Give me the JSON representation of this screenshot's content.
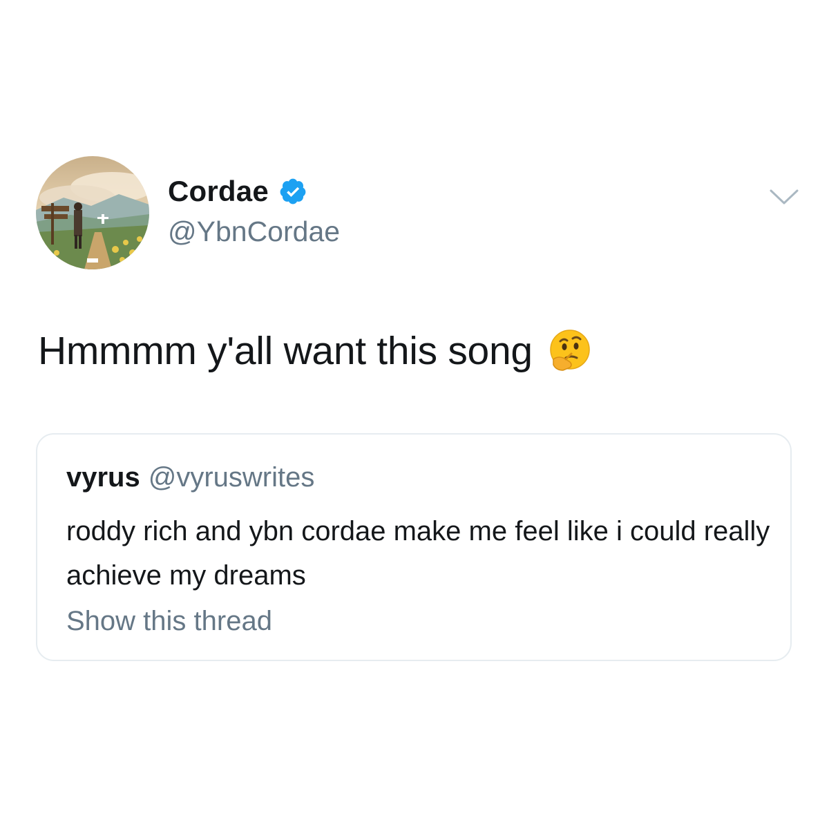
{
  "tweet": {
    "author": {
      "display_name": "Cordae",
      "handle": "@YbnCordae",
      "verified": true,
      "avatar_icon": "album-art-avatar"
    },
    "text": "Hmmmm y'all want this song",
    "emoji": "thinking-face-icon",
    "menu_icon": "chevron-down-icon",
    "quoted_tweet": {
      "display_name": "vyrus",
      "handle": "@vyruswrites",
      "text": "roddy rich and ybn cordae make me feel like i could really achieve my dreams",
      "show_thread_label": "Show this thread"
    }
  },
  "colors": {
    "text_primary": "#14171a",
    "text_secondary": "#657786",
    "verified_blue": "#1da1f2",
    "border": "#e6ecf0"
  }
}
